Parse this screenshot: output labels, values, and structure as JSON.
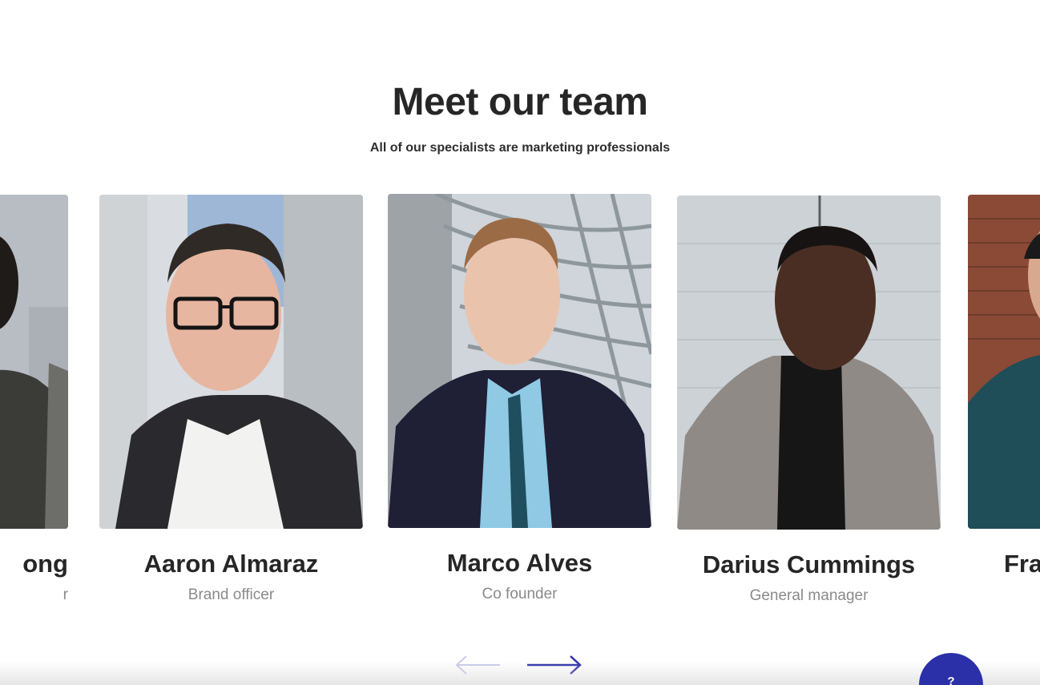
{
  "section": {
    "title": "Meet our team",
    "subtitle": "All of our specialists are marketing professionals"
  },
  "team": [
    {
      "name": "ong",
      "role": "r"
    },
    {
      "name": "Aaron Almaraz",
      "role": "Brand officer"
    },
    {
      "name": "Marco Alves",
      "role": "Co founder"
    },
    {
      "name": "Darius Cummings",
      "role": "General manager"
    },
    {
      "name": "Fra",
      "role": ""
    }
  ],
  "carousel": {
    "prev_icon": "arrow-left-icon",
    "next_icon": "arrow-right-icon"
  },
  "help_widget": {
    "label": "?",
    "accent": "#2b2fa8"
  }
}
